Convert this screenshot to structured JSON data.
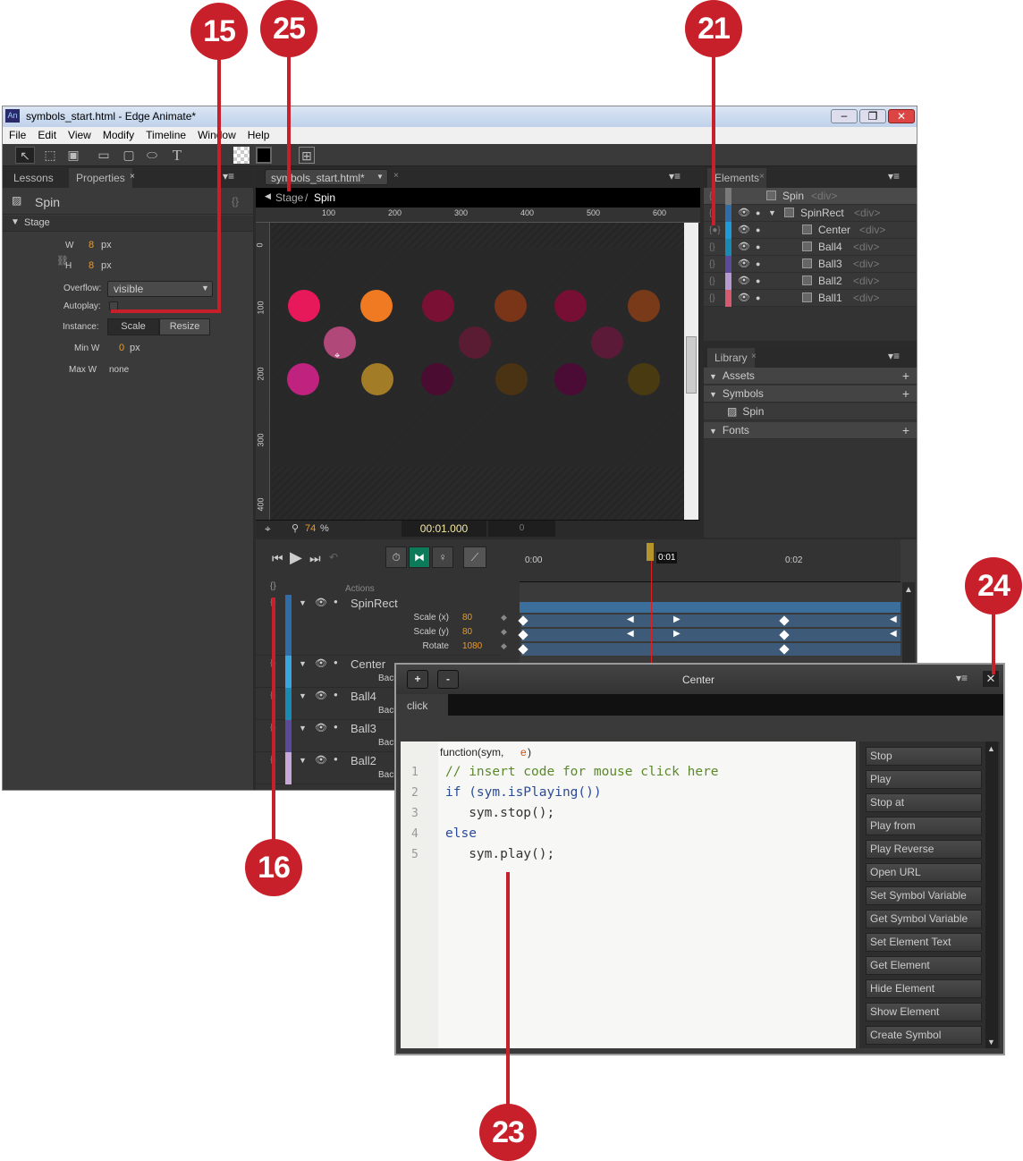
{
  "callouts": [
    "15",
    "25",
    "21",
    "24",
    "16",
    "23"
  ],
  "window": {
    "app_icon": "An",
    "title": "symbols_start.html - Edge Animate*"
  },
  "menu": [
    "File",
    "Edit",
    "View",
    "Modify",
    "Timeline",
    "Window",
    "Help"
  ],
  "toolbar": {
    "icons": [
      "select-arrow-icon",
      "transform-icon",
      "clipping-icon",
      "rectangle-icon",
      "rounded-rectangle-icon",
      "ellipse-icon",
      "text-icon",
      "background-color-icon",
      "border-color-icon",
      "grid-icon"
    ],
    "text_glyph": "T"
  },
  "left_panel": {
    "tabs": [
      "Lessons",
      "Properties"
    ],
    "symbol_name": "Spin",
    "section": "Stage",
    "w_label": "W",
    "w_value": "8",
    "h_label": "H",
    "h_value": "8",
    "unit": "px",
    "overflow_label": "Overflow:",
    "overflow_value": "visible",
    "autoplay_label": "Autoplay:",
    "autoplay_checked": false,
    "instance_label": "Instance:",
    "instance_options": [
      "Scale",
      "Resize"
    ],
    "instance_selected": "Scale",
    "minw_label": "Min W",
    "minw_value": "0",
    "maxw_label": "Max W",
    "maxw_value": "none"
  },
  "stage": {
    "doc_tab": "symbols_start.html*",
    "breadcrumb": [
      "Stage",
      "Spin"
    ],
    "ruler_x": [
      "100",
      "200",
      "300",
      "400",
      "500",
      "600"
    ],
    "ruler_y": [
      "0",
      "100",
      "200",
      "300",
      "400"
    ],
    "zoom": "74",
    "zoom_unit": "%",
    "time": "00:01.000",
    "frame": "0",
    "ball_colors": [
      "#e8195a",
      "#f07a22",
      "#7a1033",
      "#7a3418",
      "#760f33",
      "#783a18",
      "#b0487a",
      "#5a1c32",
      "#5a1a38",
      "#c0237f",
      "#a37c28",
      "#4a0c30",
      "#4a3312",
      "#4a0b35",
      "#4a3a12"
    ]
  },
  "elements": {
    "tab": "Elements",
    "items": [
      {
        "name": "Spin",
        "tag": "<div>",
        "color": "#7a7a7a"
      },
      {
        "name": "SpinRect",
        "tag": "<div>",
        "color": "#2f6ca8"
      },
      {
        "name": "Center",
        "tag": "<div>",
        "color": "#1f9ad8"
      },
      {
        "name": "Ball4",
        "tag": "<div>",
        "color": "#1a8ab5"
      },
      {
        "name": "Ball3",
        "tag": "<div>",
        "color": "#5b4a9a"
      },
      {
        "name": "Ball2",
        "tag": "<div>",
        "color": "#b79ad0"
      },
      {
        "name": "Ball1",
        "tag": "<div>",
        "color": "#d85a70"
      }
    ]
  },
  "library": {
    "tab": "Library",
    "sections": [
      "Assets",
      "Symbols",
      "Fonts"
    ],
    "symbol_item": "Spin"
  },
  "timeline": {
    "actions_label": "Actions",
    "times": [
      "0:00",
      "0:01",
      "0:02"
    ],
    "layers": [
      {
        "name": "SpinRect",
        "color": "#2f6ca8"
      },
      {
        "name": "Center",
        "color": "#3aa6e0"
      },
      {
        "name": "Ball4",
        "color": "#1a8ab5"
      },
      {
        "name": "Ball3",
        "color": "#5b4a9a"
      },
      {
        "name": "Ball2",
        "color": "#c7a8d8"
      }
    ],
    "props": [
      {
        "label": "Scale (x)",
        "value": "80"
      },
      {
        "label": "Scale (y)",
        "value": "80"
      },
      {
        "label": "Rotate",
        "value": "1080"
      }
    ],
    "sub_label": "Back"
  },
  "code_panel": {
    "title": "Center",
    "plus": "+",
    "minus": "-",
    "event_tab": "click",
    "signature": "function(sym, ",
    "sig_param": "e",
    "sig_close": ")",
    "lines": [
      {
        "n": "1",
        "text": "// insert code for mouse click here",
        "kind": "comment"
      },
      {
        "n": "2",
        "text": "if (sym.isPlaying())",
        "kind": "if"
      },
      {
        "n": "3",
        "text": "   sym.stop();",
        "kind": "code"
      },
      {
        "n": "4",
        "text": "else",
        "kind": "kw"
      },
      {
        "n": "5",
        "text": "   sym.play();",
        "kind": "code"
      }
    ],
    "snippets": [
      "Stop",
      "Play",
      "Stop at",
      "Play from",
      "Play Reverse",
      "Open URL",
      "Set Symbol Variable",
      "Get Symbol Variable",
      "Set Element Text",
      "Get Element",
      "Hide Element",
      "Show Element",
      "Create Symbol"
    ]
  }
}
